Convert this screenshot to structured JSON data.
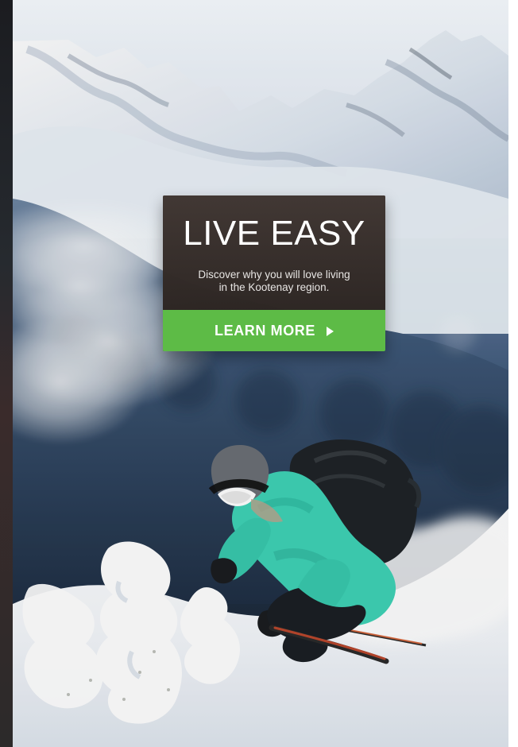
{
  "promo": {
    "title": "LIVE EASY",
    "body_line_1": "Discover why you will love living",
    "body_line_2": "in the Kootenay region.",
    "cta_label": "LEARN MORE",
    "cta_icon": "play-triangle-icon"
  },
  "theme": {
    "cta_green": "#5DBB46",
    "card_brown": "#2C2522"
  }
}
